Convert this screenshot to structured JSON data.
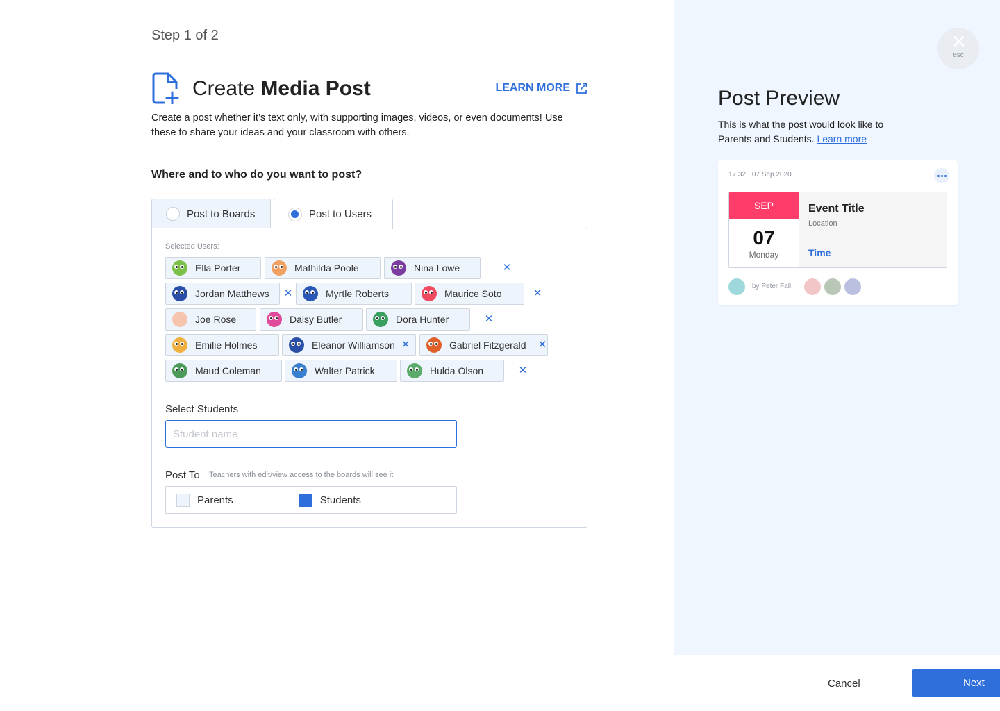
{
  "wizard": {
    "step": "Step 1 of 2"
  },
  "header": {
    "title_prefix": "Create",
    "title_bold": "Media Post",
    "learn_more": "LEARN MORE",
    "description": "Create a post whether it’s text only, with supporting images, videos, or even documents! Use these to share your ideas and your classroom with others."
  },
  "audience_question": "Where and to who do you want to post?",
  "tabs": [
    {
      "label": "Post to Boards",
      "selected": false
    },
    {
      "label": "Post to Users",
      "selected": true
    }
  ],
  "selected_users_label": "Selected Users:",
  "users": [
    {
      "name": "Ella Porter",
      "color": "#7cc04a"
    },
    {
      "name": "Mathilda Poole",
      "color": "#f0a060"
    },
    {
      "name": "Nina Lowe",
      "color": "#7a3ca0"
    },
    {
      "name": "Jordan Matthews",
      "color": "#2a4ea8"
    },
    {
      "name": "Myrtle Roberts",
      "color": "#2a56b8"
    },
    {
      "name": "Maurice Soto",
      "color": "#f04a60"
    },
    {
      "name": "Joe Rose",
      "color": "#f4a890"
    },
    {
      "name": "Daisy Butler",
      "color": "#e04a9a"
    },
    {
      "name": "Dora Hunter",
      "color": "#3aa060"
    },
    {
      "name": "Emilie Holmes",
      "color": "#f0b040"
    },
    {
      "name": "Eleanor Williamson",
      "color": "#2a4ea8"
    },
    {
      "name": "Gabriel Fitzgerald",
      "color": "#e0602a"
    },
    {
      "name": "Maud Coleman",
      "color": "#4a9a5a"
    },
    {
      "name": "Walter Patrick",
      "color": "#3a80d0"
    },
    {
      "name": "Hulda Olson",
      "color": "#5aaa6a"
    }
  ],
  "select_students": {
    "label": "Select Students",
    "placeholder": "Student name",
    "value": ""
  },
  "post_to": {
    "label": "Post To",
    "hint": "Teachers with edit/view access to the boards will see it",
    "options": [
      {
        "label": "Parents",
        "checked": false
      },
      {
        "label": "Students",
        "checked": true
      }
    ]
  },
  "close": {
    "esc": "esc"
  },
  "preview": {
    "title": "Post Preview",
    "desc": "This is what the post would look like to Parents and Students.",
    "desc_link": "Learn more",
    "card": {
      "timestamp": "17:32 · 07 Sep 2020",
      "month": "SEP",
      "day": "07",
      "weekday": "Monday",
      "event_title": "Event Title",
      "location": "Location",
      "time": "Time",
      "author": "by Peter Fall"
    }
  },
  "footer": {
    "cancel": "Cancel",
    "next": "Next"
  },
  "colors": {
    "accent": "#2f6fdc",
    "date_badge": "#ff3d6b",
    "preview_bg": "#f0f6ff"
  }
}
